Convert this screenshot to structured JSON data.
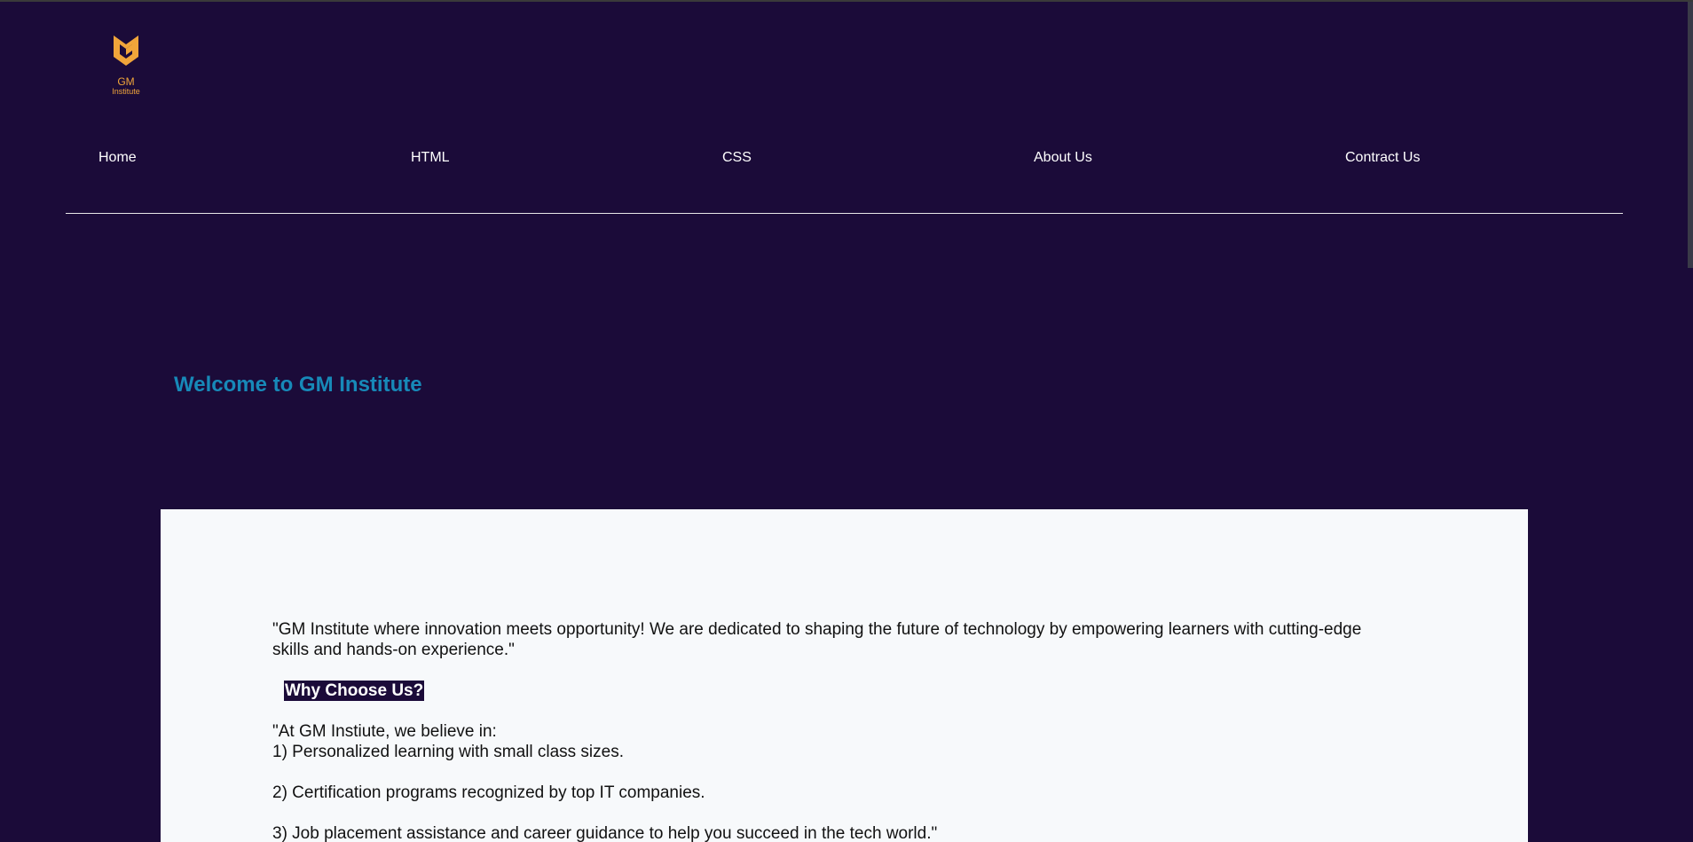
{
  "logo": {
    "icon": "gm-shield-logo-icon",
    "title": "GM",
    "subtitle": "Institute",
    "color": "#f0a53a"
  },
  "nav": {
    "items": [
      {
        "label": "Home"
      },
      {
        "label": "HTML"
      },
      {
        "label": "CSS"
      },
      {
        "label": "About Us"
      },
      {
        "label": "Contract Us"
      }
    ]
  },
  "hero": {
    "heading": "Welcome to GM Institute"
  },
  "content": {
    "intro": "\"GM Institute where innovation meets opportunity! We are dedicated to shaping the future of technology by empowering learners with cutting-edge skills and hands-on experience.\"",
    "why_heading": "Why Choose Us?",
    "beliefs_intro": "\"At GM Instiute, we believe in:",
    "points": [
      "1) Personalized learning with small class sizes.",
      "2) Certification programs recognized by top IT companies.",
      "3) Job placement assistance and career guidance to help you succeed in the tech world.\""
    ]
  },
  "colors": {
    "background": "#1b0b39",
    "accent": "#1789b8",
    "panel": "#f7f9fb"
  }
}
